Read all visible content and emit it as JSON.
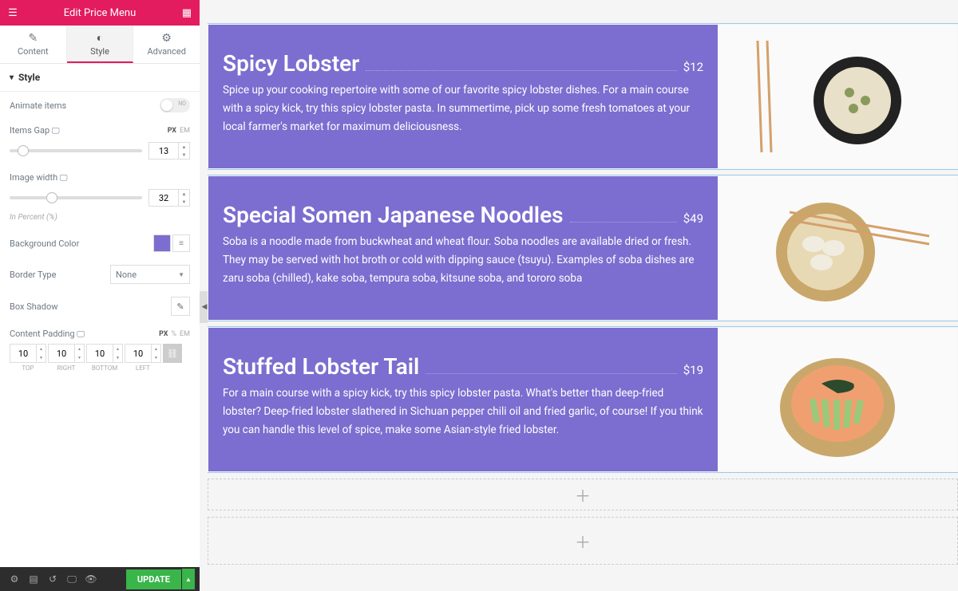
{
  "header": {
    "title": "Edit Price Menu"
  },
  "tabs": [
    {
      "id": "content",
      "label": "Content"
    },
    {
      "id": "style",
      "label": "Style"
    },
    {
      "id": "advanced",
      "label": "Advanced"
    }
  ],
  "section": {
    "title": "Style"
  },
  "controls": {
    "animate": {
      "label": "Animate items",
      "value": false,
      "off_text": "NO"
    },
    "gap": {
      "label": "Items Gap",
      "value": 13,
      "units": [
        "PX",
        "EM"
      ],
      "active_unit": "PX",
      "slider_pct": 10
    },
    "imgw": {
      "label": "Image width",
      "value": 32,
      "slider_pct": 32,
      "hint": "In Percent (%)"
    },
    "bgcolor": {
      "label": "Background Color",
      "value": "#7c6dd0"
    },
    "border": {
      "label": "Border Type",
      "value": "None"
    },
    "shadow": {
      "label": "Box Shadow"
    },
    "padding": {
      "label": "Content Padding",
      "units": [
        "PX",
        "%",
        "EM"
      ],
      "active_unit": "PX",
      "top": "10",
      "right": "10",
      "bottom": "10",
      "left": "10",
      "lbl_top": "TOP",
      "lbl_right": "RIGHT",
      "lbl_bottom": "BOTTOM",
      "lbl_left": "LEFT"
    }
  },
  "footer": {
    "update": "UPDATE"
  },
  "menu": [
    {
      "title": "Spicy Lobster",
      "price": "$12",
      "desc": "Spice up your cooking repertoire with some of our favorite spicy lobster dishes. For a main course with a spicy kick, try this spicy lobster pasta. In summertime, pick up some fresh tomatoes at your local farmer's market for maximum deliciousness."
    },
    {
      "title": "Special Somen Japanese Noodles",
      "price": "$49",
      "desc": "Soba is a noodle made from buckwheat and wheat flour. Soba noodles are available dried or fresh. They may be served with hot broth or cold with dipping sauce (tsuyu). Examples of soba dishes are zaru soba (chilled), kake soba, tempura soba, kitsune soba, and tororo soba"
    },
    {
      "title": "Stuffed Lobster Tail",
      "price": "$19",
      "desc": "For a main course with a spicy kick, try this spicy lobster pasta. What's better than deep-fried lobster? Deep-fried lobster slathered in Sichuan pepper chili oil and fried garlic, of course! If you think you can handle this level of spice, make some Asian-style fried lobster."
    }
  ]
}
